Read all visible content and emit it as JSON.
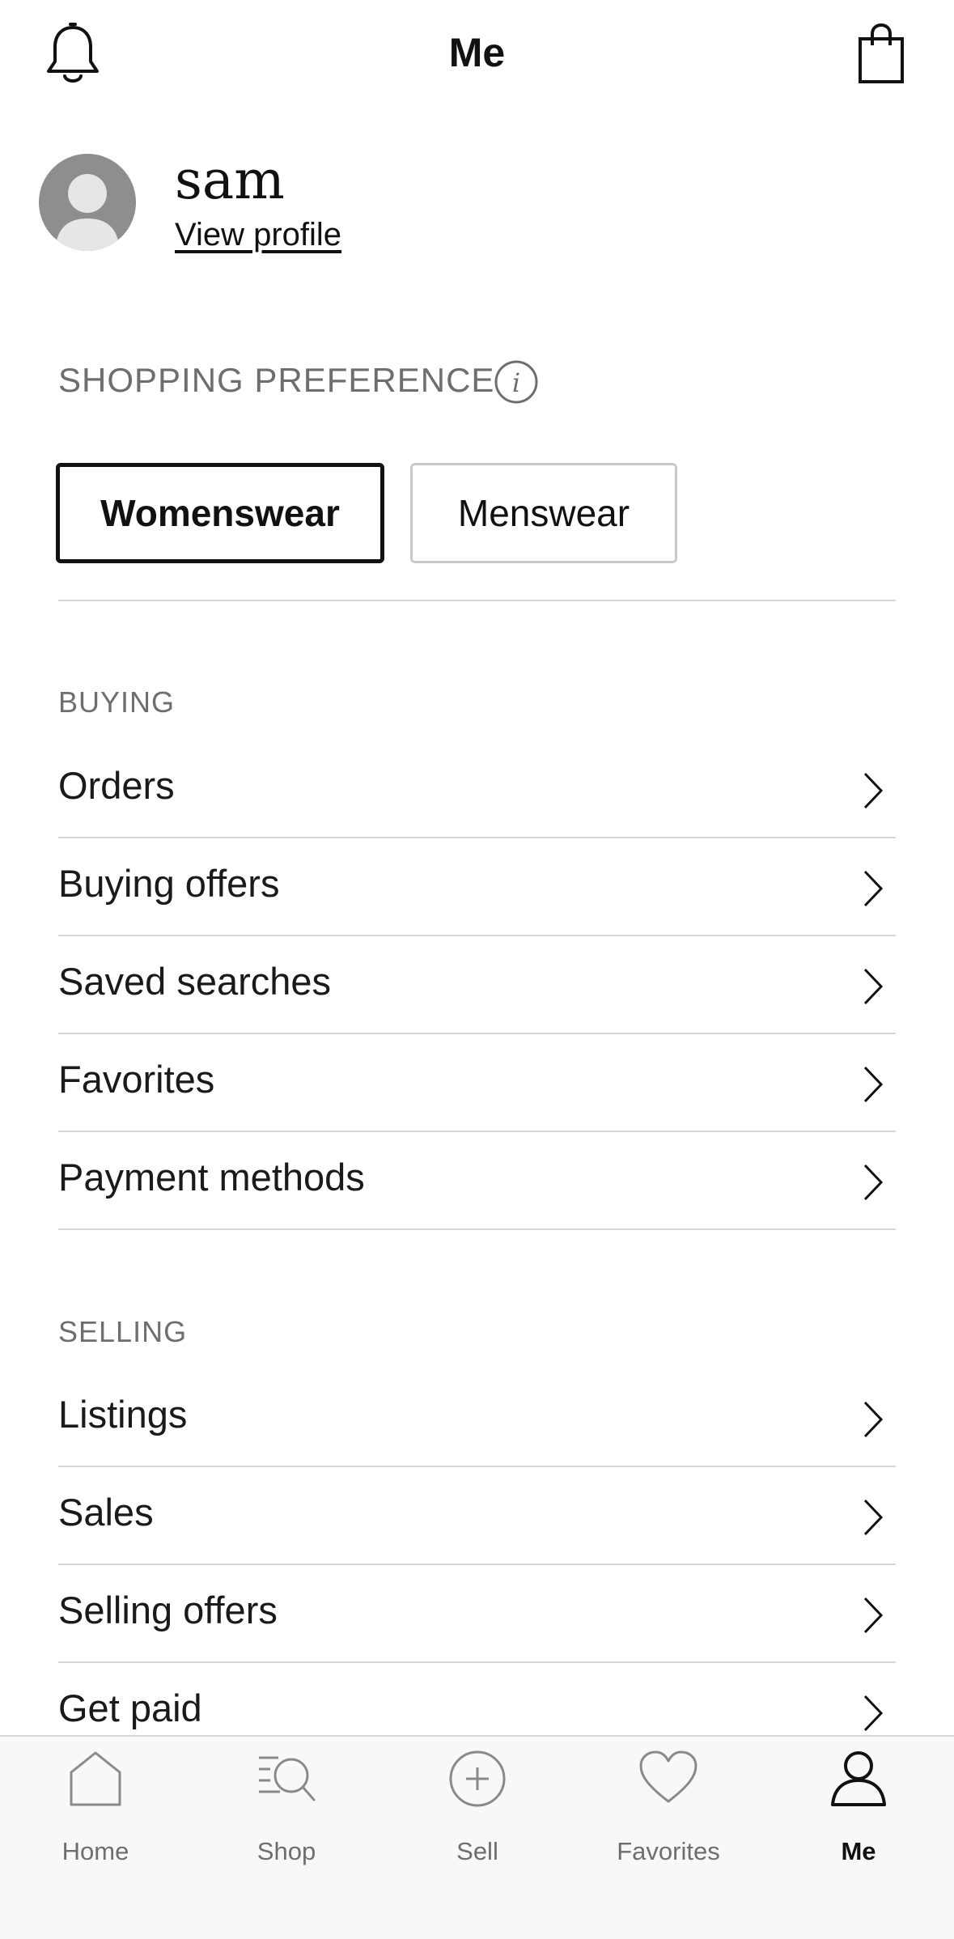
{
  "header": {
    "title": "Me",
    "notifications_icon": "bell-icon",
    "bag_icon": "shopping-bag-icon"
  },
  "profile": {
    "name": "sam",
    "view_profile_label": "View profile",
    "avatar_icon": "user-avatar-icon"
  },
  "shopping_preference": {
    "label": "SHOPPING PREFERENCE",
    "info_icon": "info-icon",
    "options": [
      "Womenswear",
      "Menswear"
    ],
    "selected": "Womenswear"
  },
  "buying": {
    "label": "BUYING",
    "items": [
      {
        "label": "Orders"
      },
      {
        "label": "Buying offers"
      },
      {
        "label": "Saved searches"
      },
      {
        "label": "Favorites"
      },
      {
        "label": "Payment methods"
      }
    ]
  },
  "selling": {
    "label": "SELLING",
    "items": [
      {
        "label": "Listings"
      },
      {
        "label": "Sales"
      },
      {
        "label": "Selling offers"
      },
      {
        "label": "Get paid"
      }
    ]
  },
  "tabbar": {
    "active": "Me",
    "tabs": [
      {
        "label": "Home",
        "icon": "home-icon"
      },
      {
        "label": "Shop",
        "icon": "search-icon"
      },
      {
        "label": "Sell",
        "icon": "plus-circle-icon"
      },
      {
        "label": "Favorites",
        "icon": "heart-icon"
      },
      {
        "label": "Me",
        "icon": "person-icon"
      }
    ]
  },
  "colors": {
    "text": "#1a1a1a",
    "muted": "#6e6e6e",
    "divider": "#d6d6d6",
    "avatar": "#8e8e8e",
    "tabbar_bg": "#f8f8f8"
  }
}
